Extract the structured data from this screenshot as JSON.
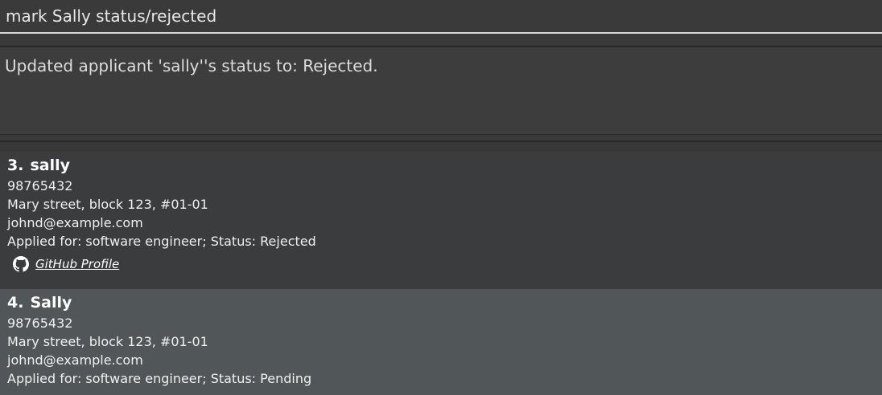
{
  "command_box": {
    "value": "mark Sally status/rejected"
  },
  "result_display": {
    "message": "Updated applicant 'sally''s status to: Rejected."
  },
  "applicants": [
    {
      "index": "3.",
      "name": "sally",
      "phone": "98765432",
      "address": "Mary street, block 123, #01-01",
      "email": "johnd@example.com",
      "applied_status": "Applied for: software engineer; Status: Rejected",
      "github_label": "GitHub Profile",
      "github_icon": "github-icon"
    },
    {
      "index": "4.",
      "name": "Sally",
      "phone": "98765432",
      "address": "Mary street, block 123, #01-01",
      "email": "johnd@example.com",
      "applied_status": "Applied for: software engineer; Status: Pending"
    }
  ],
  "colors": {
    "background": "#3a3a3a",
    "selected_card": "#515658",
    "card": "#3b3c3d",
    "text": "#f0f0f0"
  }
}
